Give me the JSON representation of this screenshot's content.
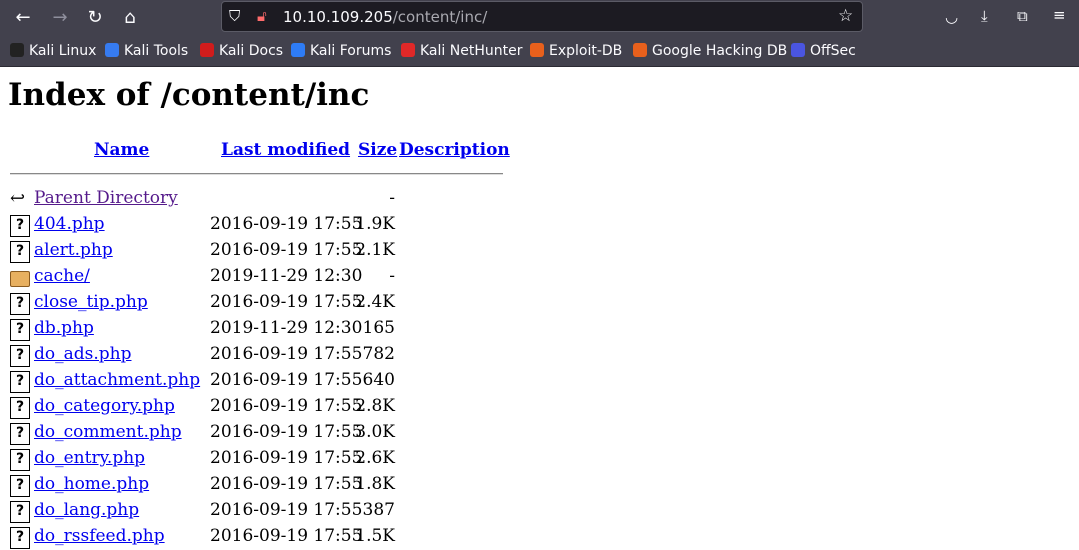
{
  "browser": {
    "url_host": "10.10.109.205",
    "url_path": "/content/inc/",
    "bookmarks": [
      {
        "label": "Kali Linux",
        "color": "#222222"
      },
      {
        "label": "Kali Tools",
        "color": "#367bf0"
      },
      {
        "label": "Kali Docs",
        "color": "#d11c1c"
      },
      {
        "label": "Kali Forums",
        "color": "#2e7cf6"
      },
      {
        "label": "Kali NetHunter",
        "color": "#e02828"
      },
      {
        "label": "Exploit-DB",
        "color": "#e8601c"
      },
      {
        "label": "Google Hacking DB",
        "color": "#e8601c"
      },
      {
        "label": "OffSec",
        "color": "#4a55e0"
      }
    ]
  },
  "page": {
    "title": "Index of /content/inc",
    "headers": {
      "name": "Name",
      "modified": "Last modified",
      "size": "Size",
      "description": "Description"
    },
    "rows": [
      {
        "icon": "back-icon",
        "name": "Parent Directory",
        "date": "",
        "size": "-"
      },
      {
        "icon": "unknown-file-icon",
        "name": "404.php",
        "date": "2016-09-19 17:55",
        "size": "1.9K"
      },
      {
        "icon": "unknown-file-icon",
        "name": "alert.php",
        "date": "2016-09-19 17:55",
        "size": "2.1K"
      },
      {
        "icon": "folder-icon",
        "name": "cache/",
        "date": "2019-11-29 12:30",
        "size": "-"
      },
      {
        "icon": "unknown-file-icon",
        "name": "close_tip.php",
        "date": "2016-09-19 17:55",
        "size": "2.4K"
      },
      {
        "icon": "unknown-file-icon",
        "name": "db.php",
        "date": "2019-11-29 12:30",
        "size": "165"
      },
      {
        "icon": "unknown-file-icon",
        "name": "do_ads.php",
        "date": "2016-09-19 17:55",
        "size": "782"
      },
      {
        "icon": "unknown-file-icon",
        "name": "do_attachment.php",
        "date": "2016-09-19 17:55",
        "size": "640"
      },
      {
        "icon": "unknown-file-icon",
        "name": "do_category.php",
        "date": "2016-09-19 17:55",
        "size": "2.8K"
      },
      {
        "icon": "unknown-file-icon",
        "name": "do_comment.php",
        "date": "2016-09-19 17:55",
        "size": "3.0K"
      },
      {
        "icon": "unknown-file-icon",
        "name": "do_entry.php",
        "date": "2016-09-19 17:55",
        "size": "2.6K"
      },
      {
        "icon": "unknown-file-icon",
        "name": "do_home.php",
        "date": "2016-09-19 17:55",
        "size": "1.8K"
      },
      {
        "icon": "unknown-file-icon",
        "name": "do_lang.php",
        "date": "2016-09-19 17:55",
        "size": "387"
      },
      {
        "icon": "unknown-file-icon",
        "name": "do_rssfeed.php",
        "date": "2016-09-19 17:55",
        "size": "1.5K"
      }
    ]
  }
}
